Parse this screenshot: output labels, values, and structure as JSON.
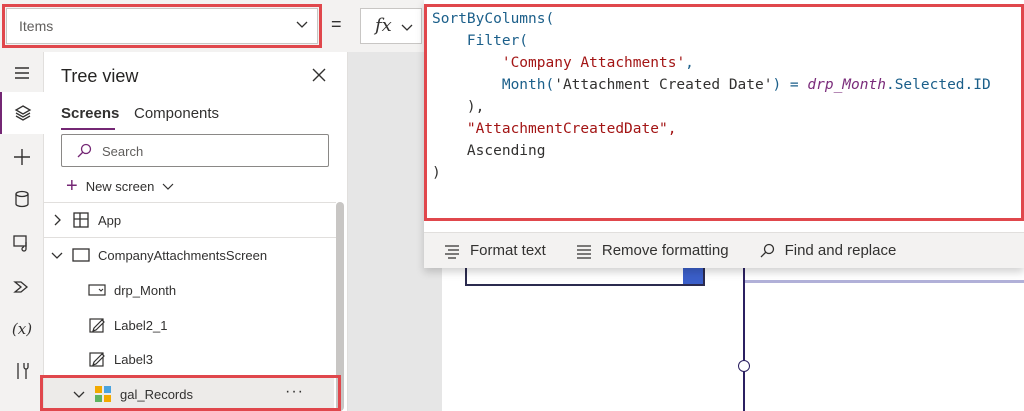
{
  "property_selector": {
    "value": "Items"
  },
  "formula_bar": {
    "equals_sign": "=",
    "fx_label": "fx",
    "code_lines": [
      "SortByColumns(",
      "    Filter(",
      "        'Company Attachments',",
      "        Month('Attachment Created Date') = drp_Month.Selected.ID",
      "    ),",
      "    \"AttachmentCreatedDate\",",
      "    Ascending",
      ")"
    ],
    "toolbar": {
      "format_text": "Format text",
      "remove_formatting": "Remove formatting",
      "find_and_replace": "Find and replace"
    }
  },
  "left_rail": {
    "items": [
      "hamburger-menu-icon",
      "layers-icon",
      "plus-icon",
      "database-icon",
      "media-icon",
      "power-automate-icon",
      "variables-icon",
      "tools-icon"
    ],
    "variables_glyph": "(x)"
  },
  "tree_view": {
    "title": "Tree view",
    "tabs": [
      {
        "label": "Screens",
        "active": true
      },
      {
        "label": "Components",
        "active": false
      }
    ],
    "search_placeholder": "Search",
    "new_screen_label": "New screen",
    "items": [
      {
        "label": "App",
        "level": 0,
        "expandable": true,
        "expanded": false,
        "icon": "app-icon"
      },
      {
        "label": "CompanyAttachmentsScreen",
        "level": 0,
        "expandable": true,
        "expanded": true,
        "icon": "screen-icon"
      },
      {
        "label": "drp_Month",
        "level": 1,
        "icon": "dropdown-icon"
      },
      {
        "label": "Label2_1",
        "level": 1,
        "icon": "label-edit-icon"
      },
      {
        "label": "Label3",
        "level": 1,
        "icon": "label-edit-icon"
      },
      {
        "label": "gal_Records",
        "level": 1,
        "expandable": true,
        "expanded": true,
        "icon": "gallery-icon",
        "selected": true,
        "more_glyph": "···"
      }
    ]
  },
  "colors": {
    "accent_purple": "#742774",
    "highlight_red": "#e0474c",
    "canvas_gray": "#e6e6e6",
    "string_red": "#a31515",
    "gallery_icon_orange": "#f2a900",
    "gallery_icon_green": "#5fb35f",
    "gallery_icon_blue": "#4aa3df"
  }
}
